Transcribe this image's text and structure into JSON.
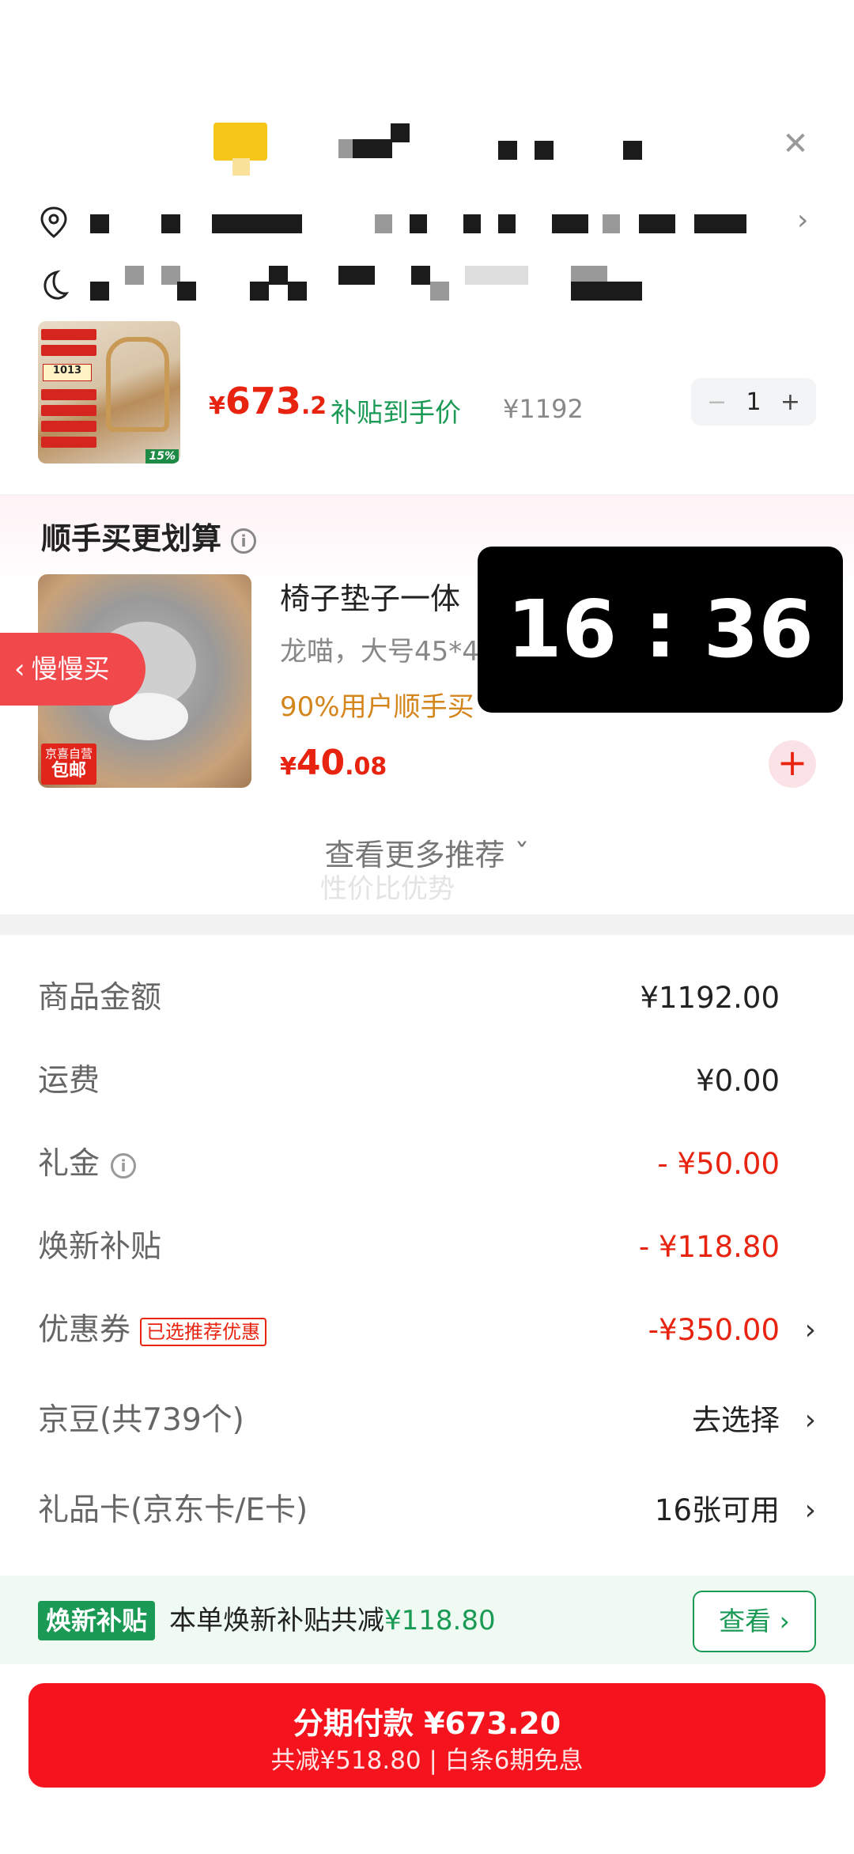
{
  "header": {
    "close_icon": "close-icon"
  },
  "address": {
    "pin_icon": "location-pin-icon",
    "chevron_icon": "chevron-right-icon"
  },
  "delivery": {
    "icon": "moon-icon"
  },
  "main_item": {
    "currency": "¥",
    "price_int": "673",
    "price_dec": ".2",
    "subsidy_label": "补贴到手价",
    "original_price": "¥1192",
    "quantity": "1",
    "minus": "−",
    "plus": "+",
    "thumb_qty": "1013",
    "thumb_pct": "15%"
  },
  "recommend": {
    "title": "顺手买更划算",
    "info_symbol": "i",
    "slow_buy_label": "慢慢买",
    "slow_buy_arrow": "‹",
    "item_name": "椅子垫子一体",
    "item_spec": "龙喵，大号45*4",
    "item_popularity": "90%用户顺手买",
    "currency": "¥",
    "price_int": "40",
    "price_dec": ".08",
    "badge_top": "京喜自营",
    "badge_bottom": "包邮",
    "add_symbol": "+",
    "more_label": "查看更多推荐 ˇ",
    "more_sub": "性价比优势"
  },
  "clock": "16 : 36",
  "summary": {
    "rows": [
      {
        "label": "商品金额",
        "value": "¥1192.00"
      },
      {
        "label": "运费",
        "value": "¥0.00"
      },
      {
        "label": "礼金",
        "value": "- ¥50.00"
      },
      {
        "label": "焕新补贴",
        "value": "- ¥118.80"
      },
      {
        "label": "优惠券",
        "tag": "已选推荐优惠",
        "value": "-¥350.00"
      },
      {
        "label": "京豆(共739个)",
        "value": "去选择"
      },
      {
        "label": "礼品卡(京东卡/E卡)",
        "value": "16张可用"
      }
    ],
    "chevron": "›",
    "info_symbol": "i"
  },
  "subsidy_bar": {
    "badge": "焕新补贴",
    "text": "本单焕新补贴共减",
    "amount": "¥118.80",
    "view_label": "查看 ›"
  },
  "pay": {
    "main": "分期付款 ¥673.20",
    "sub": "共减¥518.80 | 白条6期免息"
  },
  "colors": {
    "accent_red": "#e8230f",
    "pay_red": "#f5141e",
    "green": "#1a9a55",
    "orange": "#d4851c"
  }
}
